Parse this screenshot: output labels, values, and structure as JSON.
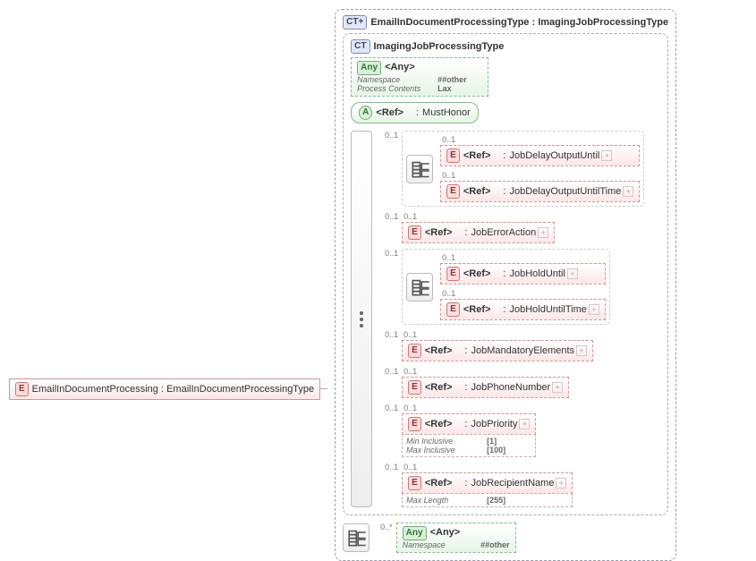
{
  "root": {
    "badge": "E",
    "name": "EmailInDocumentProcessing",
    "type": "EmailInDocumentProcessingType"
  },
  "outerCT": {
    "badge": "CT",
    "plus": true,
    "name": "EmailInDocumentProcessingType",
    "base": "ImagingJobProcessingType"
  },
  "innerCT": {
    "badge": "CT",
    "name": "ImagingJobProcessingType"
  },
  "any1": {
    "badge": "Any",
    "label": "<Any>",
    "ns": "##other",
    "pc": "Lax",
    "meta": {
      "nsKey": "Namespace",
      "pcKey": "Process Contents"
    }
  },
  "attr": {
    "badge": "A",
    "ref": "<Ref>",
    "name": "MustHonor"
  },
  "seq": {
    "occ": "0..1"
  },
  "items": [
    {
      "kind": "choice",
      "occ": "0..1",
      "children": [
        {
          "occ": "0..1",
          "ref": "<Ref>",
          "name": "JobDelayOutputUntil"
        },
        {
          "occ": "0..1",
          "ref": "<Ref>",
          "name": "JobDelayOutputUntilTime"
        }
      ]
    },
    {
      "kind": "ref",
      "occ": "0..1",
      "ref": "<Ref>",
      "name": "JobErrorAction"
    },
    {
      "kind": "choice",
      "occ": "0..1",
      "children": [
        {
          "occ": "0..1",
          "ref": "<Ref>",
          "name": "JobHoldUntil"
        },
        {
          "occ": "0..1",
          "ref": "<Ref>",
          "name": "JobHoldUntilTime"
        }
      ]
    },
    {
      "kind": "ref",
      "occ": "0..1",
      "ref": "<Ref>",
      "name": "JobMandatoryElements"
    },
    {
      "kind": "ref",
      "occ": "0..1",
      "ref": "<Ref>",
      "name": "JobPhoneNumber"
    },
    {
      "kind": "ref",
      "occ": "0..1",
      "ref": "<Ref>",
      "name": "JobPriority",
      "facets": [
        {
          "k": "Min Inclusive",
          "v": "[1]"
        },
        {
          "k": "Max Inclusive",
          "v": "[100]"
        }
      ]
    },
    {
      "kind": "ref",
      "occ": "0..1",
      "ref": "<Ref>",
      "name": "JobRecipientName",
      "facets": [
        {
          "k": "Max Length",
          "v": "[255]"
        }
      ]
    }
  ],
  "bottomChoice": {
    "occ": "0..*"
  },
  "any2": {
    "badge": "Any",
    "label": "<Any>",
    "ns": "##other",
    "meta": {
      "nsKey": "Namespace"
    }
  }
}
